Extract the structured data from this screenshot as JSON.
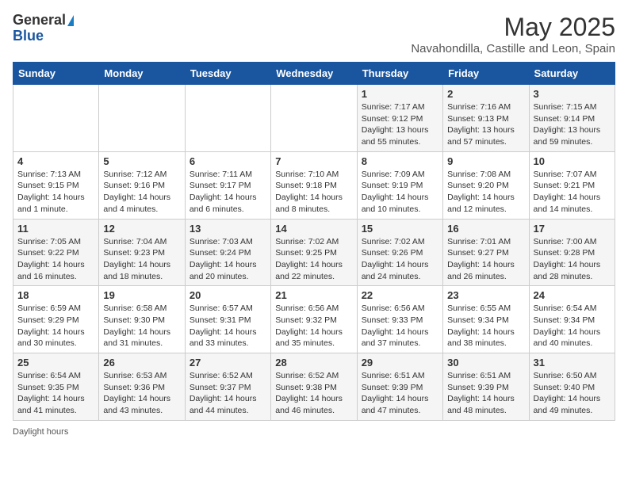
{
  "logo": {
    "general": "General",
    "blue": "Blue"
  },
  "title": "May 2025",
  "location": "Navahondilla, Castille and Leon, Spain",
  "days_of_week": [
    "Sunday",
    "Monday",
    "Tuesday",
    "Wednesday",
    "Thursday",
    "Friday",
    "Saturday"
  ],
  "weeks": [
    [
      {
        "day": "",
        "sunrise": "",
        "sunset": "",
        "daylight": ""
      },
      {
        "day": "",
        "sunrise": "",
        "sunset": "",
        "daylight": ""
      },
      {
        "day": "",
        "sunrise": "",
        "sunset": "",
        "daylight": ""
      },
      {
        "day": "",
        "sunrise": "",
        "sunset": "",
        "daylight": ""
      },
      {
        "day": "1",
        "sunrise": "Sunrise: 7:17 AM",
        "sunset": "Sunset: 9:12 PM",
        "daylight": "Daylight: 13 hours and 55 minutes."
      },
      {
        "day": "2",
        "sunrise": "Sunrise: 7:16 AM",
        "sunset": "Sunset: 9:13 PM",
        "daylight": "Daylight: 13 hours and 57 minutes."
      },
      {
        "day": "3",
        "sunrise": "Sunrise: 7:15 AM",
        "sunset": "Sunset: 9:14 PM",
        "daylight": "Daylight: 13 hours and 59 minutes."
      }
    ],
    [
      {
        "day": "4",
        "sunrise": "Sunrise: 7:13 AM",
        "sunset": "Sunset: 9:15 PM",
        "daylight": "Daylight: 14 hours and 1 minute."
      },
      {
        "day": "5",
        "sunrise": "Sunrise: 7:12 AM",
        "sunset": "Sunset: 9:16 PM",
        "daylight": "Daylight: 14 hours and 4 minutes."
      },
      {
        "day": "6",
        "sunrise": "Sunrise: 7:11 AM",
        "sunset": "Sunset: 9:17 PM",
        "daylight": "Daylight: 14 hours and 6 minutes."
      },
      {
        "day": "7",
        "sunrise": "Sunrise: 7:10 AM",
        "sunset": "Sunset: 9:18 PM",
        "daylight": "Daylight: 14 hours and 8 minutes."
      },
      {
        "day": "8",
        "sunrise": "Sunrise: 7:09 AM",
        "sunset": "Sunset: 9:19 PM",
        "daylight": "Daylight: 14 hours and 10 minutes."
      },
      {
        "day": "9",
        "sunrise": "Sunrise: 7:08 AM",
        "sunset": "Sunset: 9:20 PM",
        "daylight": "Daylight: 14 hours and 12 minutes."
      },
      {
        "day": "10",
        "sunrise": "Sunrise: 7:07 AM",
        "sunset": "Sunset: 9:21 PM",
        "daylight": "Daylight: 14 hours and 14 minutes."
      }
    ],
    [
      {
        "day": "11",
        "sunrise": "Sunrise: 7:05 AM",
        "sunset": "Sunset: 9:22 PM",
        "daylight": "Daylight: 14 hours and 16 minutes."
      },
      {
        "day": "12",
        "sunrise": "Sunrise: 7:04 AM",
        "sunset": "Sunset: 9:23 PM",
        "daylight": "Daylight: 14 hours and 18 minutes."
      },
      {
        "day": "13",
        "sunrise": "Sunrise: 7:03 AM",
        "sunset": "Sunset: 9:24 PM",
        "daylight": "Daylight: 14 hours and 20 minutes."
      },
      {
        "day": "14",
        "sunrise": "Sunrise: 7:02 AM",
        "sunset": "Sunset: 9:25 PM",
        "daylight": "Daylight: 14 hours and 22 minutes."
      },
      {
        "day": "15",
        "sunrise": "Sunrise: 7:02 AM",
        "sunset": "Sunset: 9:26 PM",
        "daylight": "Daylight: 14 hours and 24 minutes."
      },
      {
        "day": "16",
        "sunrise": "Sunrise: 7:01 AM",
        "sunset": "Sunset: 9:27 PM",
        "daylight": "Daylight: 14 hours and 26 minutes."
      },
      {
        "day": "17",
        "sunrise": "Sunrise: 7:00 AM",
        "sunset": "Sunset: 9:28 PM",
        "daylight": "Daylight: 14 hours and 28 minutes."
      }
    ],
    [
      {
        "day": "18",
        "sunrise": "Sunrise: 6:59 AM",
        "sunset": "Sunset: 9:29 PM",
        "daylight": "Daylight: 14 hours and 30 minutes."
      },
      {
        "day": "19",
        "sunrise": "Sunrise: 6:58 AM",
        "sunset": "Sunset: 9:30 PM",
        "daylight": "Daylight: 14 hours and 31 minutes."
      },
      {
        "day": "20",
        "sunrise": "Sunrise: 6:57 AM",
        "sunset": "Sunset: 9:31 PM",
        "daylight": "Daylight: 14 hours and 33 minutes."
      },
      {
        "day": "21",
        "sunrise": "Sunrise: 6:56 AM",
        "sunset": "Sunset: 9:32 PM",
        "daylight": "Daylight: 14 hours and 35 minutes."
      },
      {
        "day": "22",
        "sunrise": "Sunrise: 6:56 AM",
        "sunset": "Sunset: 9:33 PM",
        "daylight": "Daylight: 14 hours and 37 minutes."
      },
      {
        "day": "23",
        "sunrise": "Sunrise: 6:55 AM",
        "sunset": "Sunset: 9:34 PM",
        "daylight": "Daylight: 14 hours and 38 minutes."
      },
      {
        "day": "24",
        "sunrise": "Sunrise: 6:54 AM",
        "sunset": "Sunset: 9:34 PM",
        "daylight": "Daylight: 14 hours and 40 minutes."
      }
    ],
    [
      {
        "day": "25",
        "sunrise": "Sunrise: 6:54 AM",
        "sunset": "Sunset: 9:35 PM",
        "daylight": "Daylight: 14 hours and 41 minutes."
      },
      {
        "day": "26",
        "sunrise": "Sunrise: 6:53 AM",
        "sunset": "Sunset: 9:36 PM",
        "daylight": "Daylight: 14 hours and 43 minutes."
      },
      {
        "day": "27",
        "sunrise": "Sunrise: 6:52 AM",
        "sunset": "Sunset: 9:37 PM",
        "daylight": "Daylight: 14 hours and 44 minutes."
      },
      {
        "day": "28",
        "sunrise": "Sunrise: 6:52 AM",
        "sunset": "Sunset: 9:38 PM",
        "daylight": "Daylight: 14 hours and 46 minutes."
      },
      {
        "day": "29",
        "sunrise": "Sunrise: 6:51 AM",
        "sunset": "Sunset: 9:39 PM",
        "daylight": "Daylight: 14 hours and 47 minutes."
      },
      {
        "day": "30",
        "sunrise": "Sunrise: 6:51 AM",
        "sunset": "Sunset: 9:39 PM",
        "daylight": "Daylight: 14 hours and 48 minutes."
      },
      {
        "day": "31",
        "sunrise": "Sunrise: 6:50 AM",
        "sunset": "Sunset: 9:40 PM",
        "daylight": "Daylight: 14 hours and 49 minutes."
      }
    ]
  ],
  "footer_label": "Daylight hours"
}
